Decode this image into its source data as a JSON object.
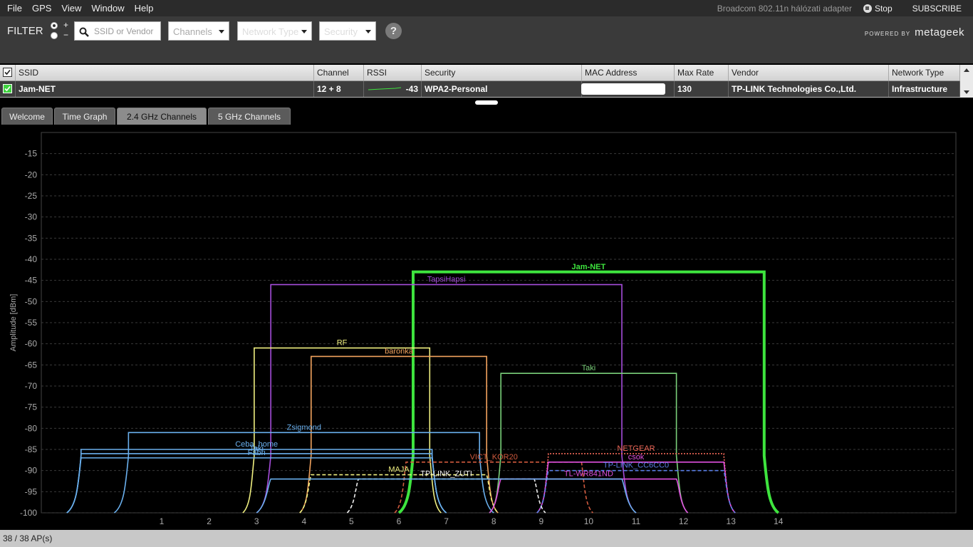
{
  "menu": {
    "items": [
      "File",
      "GPS",
      "View",
      "Window",
      "Help"
    ],
    "adapter": "Broadcom 802.11n hálózati adapter",
    "stop": "Stop",
    "subscribe": "SUBSCRIBE"
  },
  "filter": {
    "label": "FILTER",
    "plus": "+",
    "minus": "−",
    "search_placeholder": "SSID or Vendor",
    "channels": "Channels",
    "network_type": "Network Type",
    "security": "Security",
    "help": "?",
    "powered_by": "POWERED BY",
    "brand": "metageek"
  },
  "table": {
    "headers": [
      "SSID",
      "Channel",
      "RSSI",
      "Security",
      "MAC Address",
      "Max Rate",
      "Vendor",
      "Network Type"
    ],
    "rows": [
      {
        "ssid": "Jam-NET",
        "channel": "12 + 8",
        "rssi": "-43",
        "security": "WPA2-Personal",
        "mac": "",
        "max_rate": "130",
        "vendor": "TP-LINK Technologies Co.,Ltd.",
        "network_type": "Infrastructure"
      }
    ]
  },
  "tabs": [
    "Welcome",
    "Time Graph",
    "2.4 GHz Channels",
    "5 GHz Channels"
  ],
  "colors": {
    "jamnet": "#3ee43e",
    "bg": "#000000",
    "grid": "#444444"
  },
  "chart_data": {
    "type": "area",
    "ylabel": "Amplitude [dBm]",
    "ylim": [
      -100,
      -10
    ],
    "yticks": [
      -15,
      -20,
      -25,
      -30,
      -35,
      -40,
      -45,
      -50,
      -55,
      -60,
      -65,
      -70,
      -75,
      -80,
      -85,
      -90,
      -95,
      -100
    ],
    "xticks": [
      1,
      2,
      3,
      4,
      5,
      6,
      7,
      8,
      9,
      10,
      11,
      12,
      13,
      14
    ],
    "grid": true,
    "series": [
      {
        "name": "Jam-NET",
        "center": 10,
        "width": 40,
        "level": -43,
        "color": "#3ee43e",
        "style": "solid",
        "bold": true
      },
      {
        "name": "TapsiHapsi",
        "center": 7,
        "width": 40,
        "level": -46,
        "color": "#a64ddb",
        "style": "solid"
      },
      {
        "name": "RF",
        "center": 4.8,
        "width": 20,
        "level": -61,
        "color": "#f0f080",
        "style": "solid"
      },
      {
        "name": "baronka",
        "center": 6,
        "width": 20,
        "level": -63,
        "color": "#f2a35e",
        "style": "solid"
      },
      {
        "name": "Taki",
        "center": 10,
        "width": 20,
        "level": -67,
        "color": "#7ad07a",
        "style": "solid"
      },
      {
        "name": "Zsigmond",
        "center": 4,
        "width": 40,
        "level": -81,
        "color": "#6ab0ee",
        "style": "solid"
      },
      {
        "name": "Ceba_home",
        "center": 3,
        "width": 40,
        "level": -85,
        "color": "#6ab0ee",
        "style": "solid"
      },
      {
        "name": "Taki",
        "center": 3,
        "width": 40,
        "level": -86,
        "color": "#6ab0ee",
        "style": "solid"
      },
      {
        "name": "Fabri",
        "center": 3,
        "width": 40,
        "level": -87,
        "color": "#6ab0ee",
        "style": "solid"
      },
      {
        "name": "VICT_KOR20",
        "center": 8,
        "width": 20,
        "level": -88,
        "color": "#d05a3e",
        "style": "dashed"
      },
      {
        "name": "NETGEAR",
        "center": 11,
        "width": 20,
        "level": -86,
        "color": "#f06858",
        "style": "dotted"
      },
      {
        "name": "csok",
        "center": 11,
        "width": 20,
        "level": -88,
        "color": "#e050e0",
        "style": "solid"
      },
      {
        "name": "TP-LINK_CC6CC0",
        "center": 11,
        "width": 20,
        "level": -90,
        "color": "#5a7ee6",
        "style": "dashed"
      },
      {
        "name": "MAJA",
        "center": 6,
        "width": 20,
        "level": -91,
        "color": "#f0f080",
        "style": "dashed"
      },
      {
        "name": "TP-LINK_ZUTI",
        "center": 7,
        "width": 20,
        "level": -92,
        "color": "#eeeeee",
        "style": "dashed"
      },
      {
        "name": "TL-WR841ND",
        "center": 10,
        "width": 20,
        "level": -92,
        "color": "#e050e0",
        "style": "solid"
      },
      {
        "name": "",
        "center": 7,
        "width": 40,
        "level": -92,
        "color": "#6ab0ee",
        "style": "solid"
      }
    ]
  },
  "status": {
    "aps": "38 / 38 AP(s)"
  }
}
